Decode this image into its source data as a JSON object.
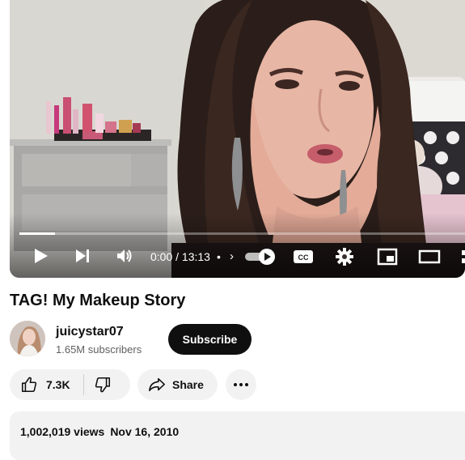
{
  "player": {
    "current_time": "0:00",
    "separator": " / ",
    "duration": "13:13",
    "chapter_dot": "•",
    "progress_fraction": 0.0,
    "buffered_fraction": 0.08,
    "autoplay_on": true,
    "controls": {
      "play": "play-icon",
      "next": "next-icon",
      "volume": "volume-icon",
      "autoplay": "autoplay-toggle",
      "captions": "CC",
      "settings": "gear-icon",
      "miniplayer": "miniplayer-icon",
      "theater": "theater-icon"
    }
  },
  "video": {
    "title": "TAG! My Makeup Story"
  },
  "channel": {
    "name": "juicystar07",
    "subscribers": "1.65M subscribers",
    "subscribe_label": "Subscribe"
  },
  "actions": {
    "likes": "7.3K",
    "share_label": "Share",
    "more_label": "⋯"
  },
  "description": {
    "views": "1,002,019 views",
    "date": "Nov 16, 2010"
  },
  "colors": {
    "subscribe_bg": "#0f0f0f",
    "pill_bg": "#f2f2f2",
    "text_secondary": "#606060"
  }
}
